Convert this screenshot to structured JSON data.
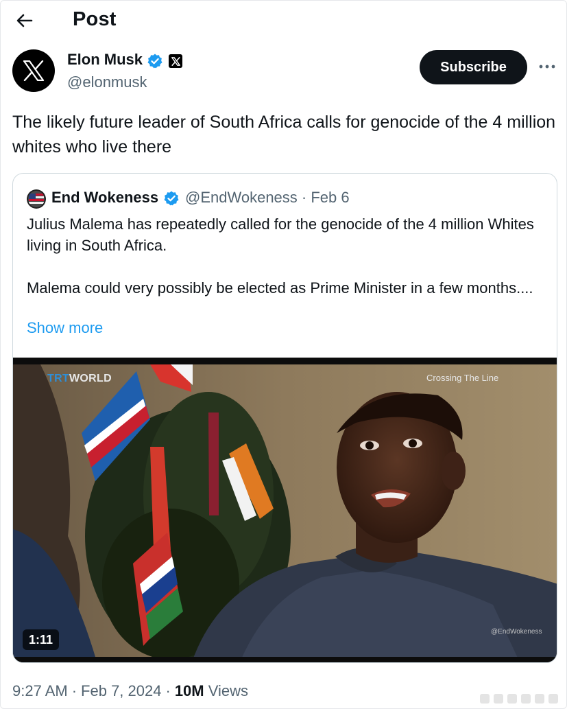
{
  "header": {
    "title": "Post",
    "back_icon": "arrow-left-icon"
  },
  "post": {
    "author": {
      "name": "Elon Musk",
      "handle": "@elonmusk",
      "avatar_icon": "x-logo-icon",
      "verified": true,
      "affiliate_badge_icon": "x-logo-icon"
    },
    "subscribe_label": "Subscribe",
    "more_icon": "more-dots-icon",
    "text": "The likely future leader of South Africa calls for genocide of the 4 million whites who live there",
    "meta": {
      "time": "9:27 AM",
      "date": "Feb 7, 2024",
      "views_count": "10M",
      "views_label": "Views",
      "separator": "·"
    }
  },
  "quoted": {
    "author": {
      "name": "End Wokeness",
      "handle_date": "@EndWokeness · Feb 6",
      "verified": true
    },
    "paragraphs": [
      "Julius Malema has repeatedly called for the genocide of the 4 million Whites living in South Africa.",
      "Malema could very possibly be elected as Prime Minister in a few months...."
    ],
    "show_more": "Show more",
    "video": {
      "channel_logo_a": "TRT",
      "channel_logo_b": "WORLD",
      "show_title": "Crossing The Line",
      "watermark": "@EndWokeness",
      "duration": "1:11"
    }
  },
  "colors": {
    "text": "#0f1419",
    "secondary": "#536471",
    "link": "#1d9bf0",
    "verified": "#1d9bf0",
    "border": "#cfd9de"
  }
}
